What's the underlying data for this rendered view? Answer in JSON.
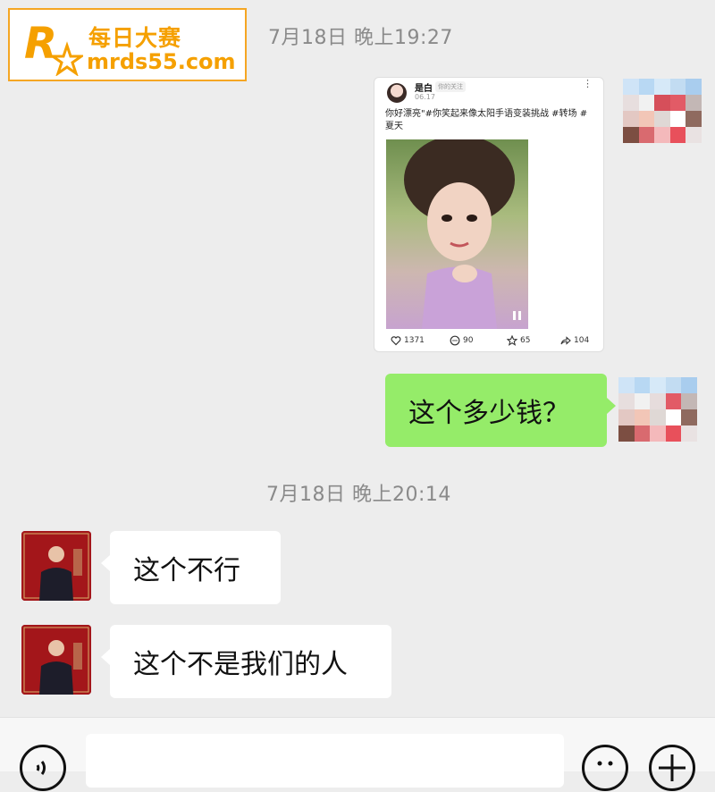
{
  "watermark": {
    "brand_cn": "每日大赛",
    "url": "mrds55.com",
    "logo_small": "每日大赛"
  },
  "timestamps": [
    "7月18日 晚上19:27",
    "7月18日 晚上20:14"
  ],
  "shared_post": {
    "author": "是白",
    "follow_tag": "你的关注",
    "time": "06.17",
    "caption": "你好漂亮\"#你笑起来像太阳手语变装挑战 #转场 #夏天",
    "likes": "1371",
    "comments": "90",
    "favorites": "65",
    "shares": "104"
  },
  "messages": [
    {
      "from": "me",
      "text": "这个多少钱？"
    },
    {
      "from": "other",
      "text": "这个不行"
    },
    {
      "from": "other",
      "text": "这个不是我们的人"
    }
  ],
  "colors": {
    "my_bubble": "#95ec69",
    "other_bubble": "#ffffff",
    "background": "#ededed",
    "accent": "#f5a000"
  },
  "icons": {
    "voice": "voice-icon",
    "emoji": "emoji-icon",
    "add": "plus-icon",
    "pause": "pause-icon"
  }
}
